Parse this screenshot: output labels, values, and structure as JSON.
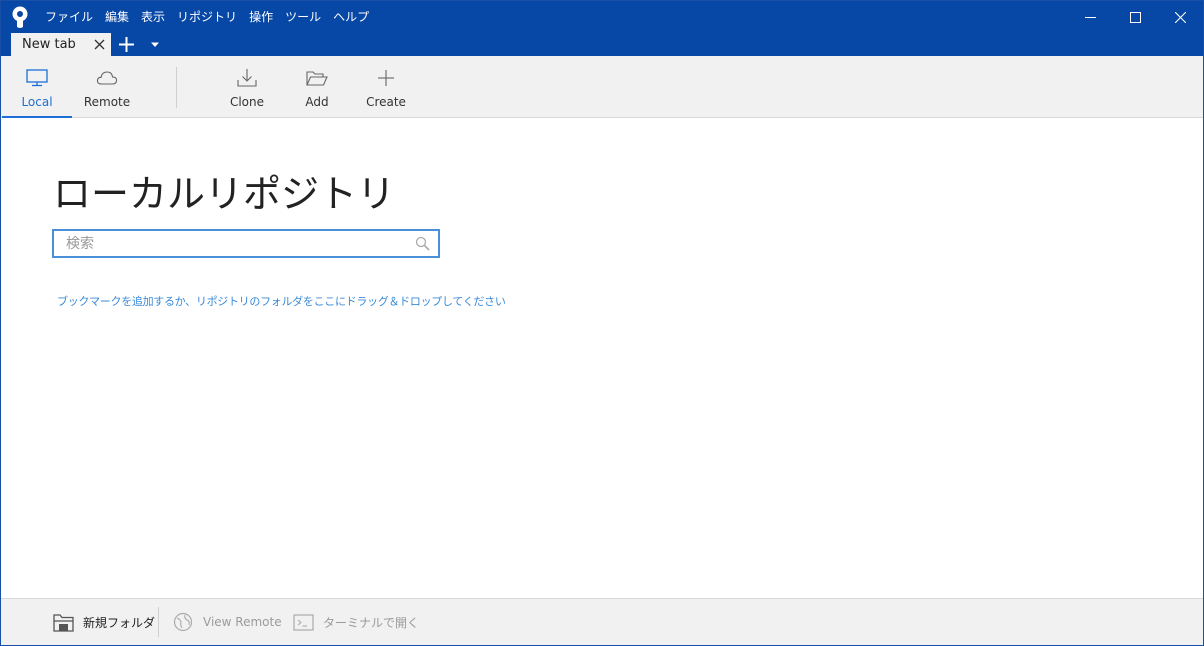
{
  "menubar": {
    "items": [
      "ファイル",
      "編集",
      "表示",
      "リポジトリ",
      "操作",
      "ツール",
      "ヘルプ"
    ]
  },
  "tabs": {
    "items": [
      {
        "label": "New tab"
      }
    ]
  },
  "toolbar": {
    "local_label": "Local",
    "remote_label": "Remote",
    "clone_label": "Clone",
    "add_label": "Add",
    "create_label": "Create"
  },
  "main": {
    "title": "ローカルリポジトリ",
    "search_placeholder": "検索",
    "search_value": "",
    "hint": "ブックマークを追加するか、リポジトリのフォルダをここにドラッグ＆ドロップしてください"
  },
  "footer": {
    "new_folder_label": "新規フォルダ",
    "view_remote_label": "View Remote",
    "open_terminal_label": "ターミナルで開く"
  },
  "colors": {
    "titlebar": "#0747a6",
    "accent": "#1d6fd6",
    "link": "#3b8ad9"
  }
}
